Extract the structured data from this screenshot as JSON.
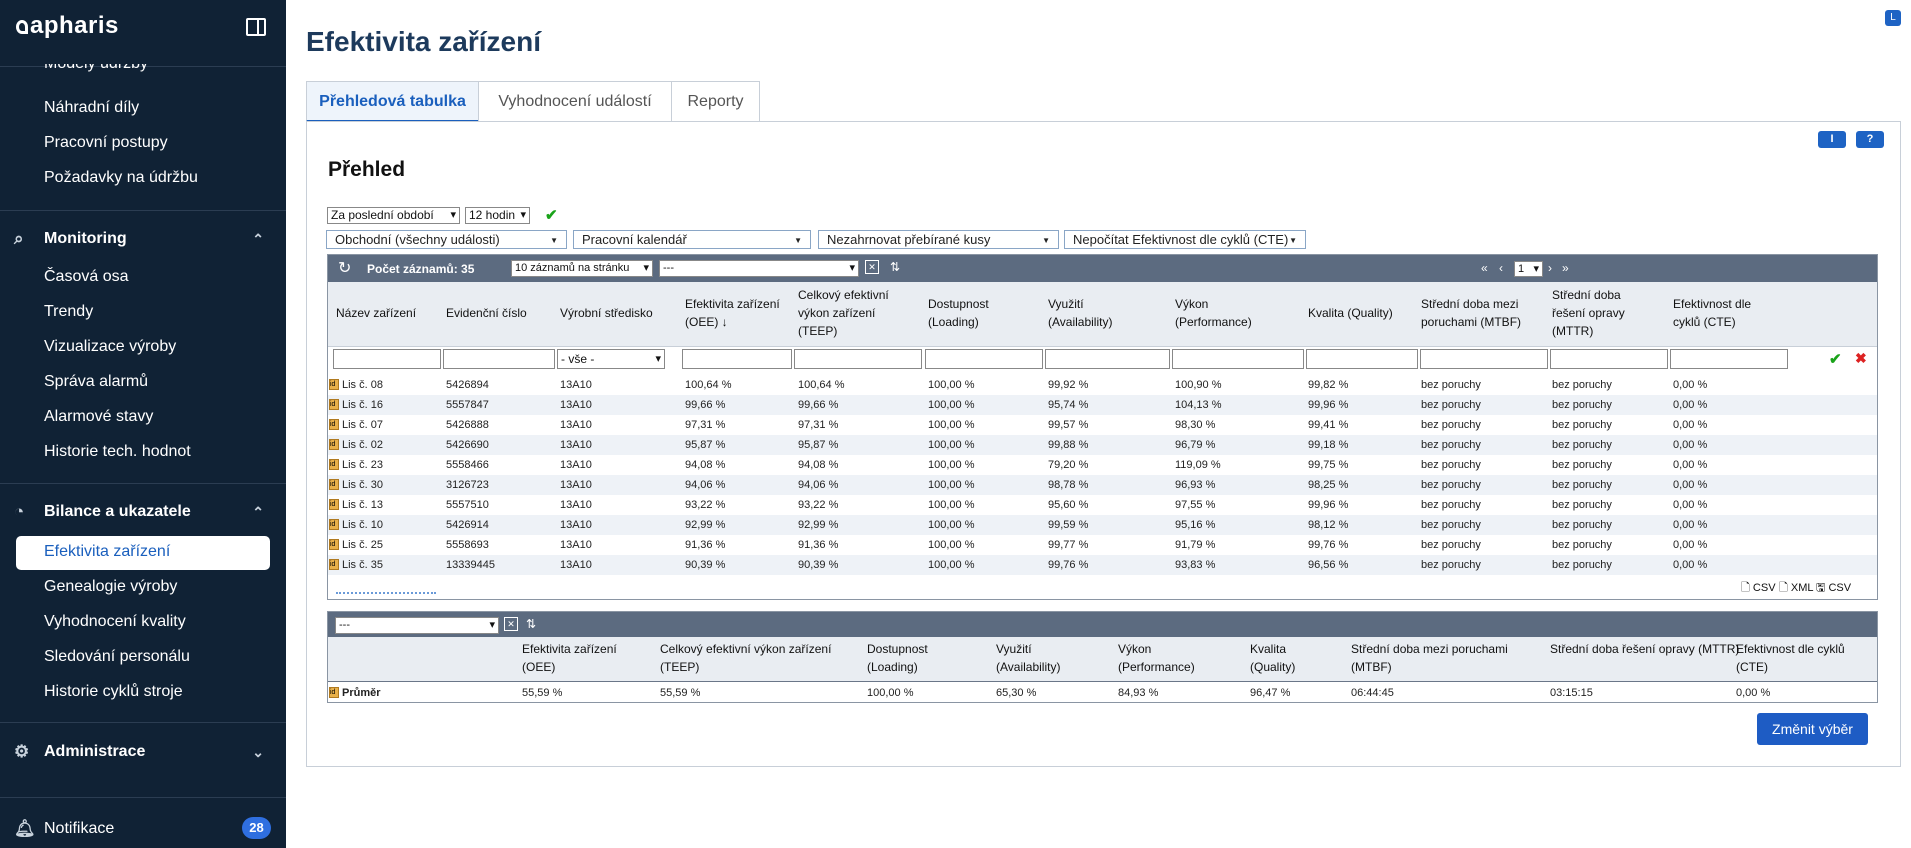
{
  "app": {
    "logo": "apharis",
    "corner_badge": "L"
  },
  "sidebar": {
    "top_items": [
      "Modely údržby",
      "Náhradní díly",
      "Pracovní postupy",
      "Požadavky na údržbu"
    ],
    "monitoring": {
      "title": "Monitoring",
      "items": [
        "Časová osa",
        "Trendy",
        "Vizualizace výroby",
        "Správa alarmů",
        "Alarmové stavy",
        "Historie tech. hodnot"
      ]
    },
    "bilance": {
      "title": "Bilance a ukazatele",
      "items": [
        "Efektivita zařízení",
        "Genealogie výroby",
        "Vyhodnocení kvality",
        "Sledování personálu",
        "Historie cyklů stroje"
      ],
      "active": "Efektivita zařízení"
    },
    "administrace": {
      "title": "Administrace"
    },
    "notifikace": {
      "title": "Notifikace",
      "count": "28"
    }
  },
  "page": {
    "title": "Efektivita zařízení",
    "tabs": [
      "Přehledová tabulka",
      "Vyhodnocení událostí",
      "Reporty"
    ],
    "help_i": "I",
    "help_q": "?"
  },
  "panel": {
    "title": "Přehled",
    "period": "Za poslední období",
    "period_len": "12 hodin",
    "filters": [
      "Obchodní (všechny události)",
      "Pracovní kalendář",
      "Nezahrnovat přebírané kusy",
      "Nepočítat Efektivnost dle cyklů (CTE)"
    ],
    "records_label": "Počet záznamů: 35",
    "per_page": "10 záznamů na stránku",
    "view_select": "---",
    "page_num": "1",
    "col_filter_select": "- vše -",
    "columns": [
      "Název zařízení",
      "Evidenční číslo",
      "Výrobní středisko",
      "Efektivita zařízení (OEE) ↓",
      "Celkový efektivní výkon zařízení (TEEP)",
      "Dostupnost (Loading)",
      "Využití (Availability)",
      "Výkon (Performance)",
      "Kvalita (Quality)",
      "Střední doba mezi poruchami (MTBF)",
      "Střední doba řešení opravy (MTTR)",
      "Efektivnost dle cyklů (CTE)"
    ],
    "rows": [
      [
        "Lis č. 08",
        "5426894",
        "13A10",
        "100,64 %",
        "100,64 %",
        "100,00 %",
        "99,92 %",
        "100,90 %",
        "99,82 %",
        "bez poruchy",
        "bez poruchy",
        "0,00 %"
      ],
      [
        "Lis č. 16",
        "5557847",
        "13A10",
        "99,66 %",
        "99,66 %",
        "100,00 %",
        "95,74 %",
        "104,13 %",
        "99,96 %",
        "bez poruchy",
        "bez poruchy",
        "0,00 %"
      ],
      [
        "Lis č. 07",
        "5426888",
        "13A10",
        "97,31 %",
        "97,31 %",
        "100,00 %",
        "99,57 %",
        "98,30 %",
        "99,41 %",
        "bez poruchy",
        "bez poruchy",
        "0,00 %"
      ],
      [
        "Lis č. 02",
        "5426690",
        "13A10",
        "95,87 %",
        "95,87 %",
        "100,00 %",
        "99,88 %",
        "96,79 %",
        "99,18 %",
        "bez poruchy",
        "bez poruchy",
        "0,00 %"
      ],
      [
        "Lis č. 23",
        "5558466",
        "13A10",
        "94,08 %",
        "94,08 %",
        "100,00 %",
        "79,20 %",
        "119,09 %",
        "99,75 %",
        "bez poruchy",
        "bez poruchy",
        "0,00 %"
      ],
      [
        "Lis č. 30",
        "3126723",
        "13A10",
        "94,06 %",
        "94,06 %",
        "100,00 %",
        "98,78 %",
        "96,93 %",
        "98,25 %",
        "bez poruchy",
        "bez poruchy",
        "0,00 %"
      ],
      [
        "Lis č. 13",
        "5557510",
        "13A10",
        "93,22 %",
        "93,22 %",
        "100,00 %",
        "95,60 %",
        "97,55 %",
        "99,96 %",
        "bez poruchy",
        "bez poruchy",
        "0,00 %"
      ],
      [
        "Lis č. 10",
        "5426914",
        "13A10",
        "92,99 %",
        "92,99 %",
        "100,00 %",
        "99,59 %",
        "95,16 %",
        "98,12 %",
        "bez poruchy",
        "bez poruchy",
        "0,00 %"
      ],
      [
        "Lis č. 25",
        "5558693",
        "13A10",
        "91,36 %",
        "91,36 %",
        "100,00 %",
        "99,77 %",
        "91,79 %",
        "99,76 %",
        "bez poruchy",
        "bez poruchy",
        "0,00 %"
      ],
      [
        "Lis č. 35",
        "13339445",
        "13A10",
        "90,39 %",
        "90,39 %",
        "100,00 %",
        "99,76 %",
        "93,83 %",
        "96,56 %",
        "bez poruchy",
        "bez poruchy",
        "0,00 %"
      ]
    ],
    "exports": [
      "CSV",
      "XML",
      "CSV"
    ],
    "row_icon": "id"
  },
  "summary": {
    "select": "---",
    "columns": [
      "Efektivita zařízení (OEE)",
      "Celkový efektivní výkon zařízení (TEEP)",
      "Dostupnost (Loading)",
      "Využití (Availability)",
      "Výkon (Performance)",
      "Kvalita (Quality)",
      "Střední doba mezi poruchami (MTBF)",
      "Střední doba řešení opravy (MTTR)",
      "Efektivnost dle cyklů (CTE)"
    ],
    "row_label": "Průměr",
    "values": [
      "55,59 %",
      "55,59 %",
      "100,00 %",
      "65,30 %",
      "84,93 %",
      "96,47 %",
      "06:44:45",
      "03:15:15",
      "0,00 %"
    ]
  },
  "buttons": {
    "change": "Změnit výběr"
  }
}
